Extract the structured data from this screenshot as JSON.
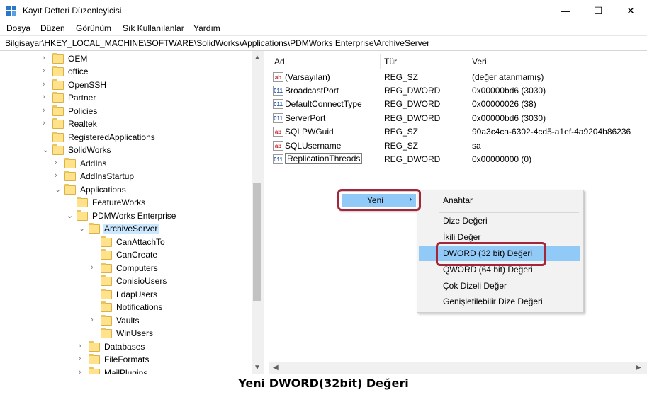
{
  "window": {
    "title": "Kayıt Defteri Düzenleyicisi",
    "minimize_glyph": "—",
    "maximize_glyph": "☐",
    "close_glyph": "✕"
  },
  "menu": [
    "Dosya",
    "Düzen",
    "Görünüm",
    "Sık Kullanılanlar",
    "Yardım"
  ],
  "address": "Bilgisayar\\HKEY_LOCAL_MACHINE\\SOFTWARE\\SolidWorks\\Applications\\PDMWorks Enterprise\\ArchiveServer",
  "tree": [
    {
      "label": "OEM",
      "expander": "›"
    },
    {
      "label": "office",
      "expander": "›"
    },
    {
      "label": "OpenSSH",
      "expander": "›"
    },
    {
      "label": "Partner",
      "expander": "›"
    },
    {
      "label": "Policies",
      "expander": "›"
    },
    {
      "label": "Realtek",
      "expander": "›"
    },
    {
      "label": "RegisteredApplications",
      "expander": ""
    },
    {
      "label": "SolidWorks",
      "expander": "⌄"
    },
    {
      "label": "AddIns",
      "expander": "›"
    },
    {
      "label": "AddInsStartup",
      "expander": "›"
    },
    {
      "label": "Applications",
      "expander": "⌄"
    },
    {
      "label": "FeatureWorks",
      "expander": ""
    },
    {
      "label": "PDMWorks Enterprise",
      "expander": "⌄"
    },
    {
      "label": "ArchiveServer",
      "expander": "⌄"
    },
    {
      "label": "CanAttachTo",
      "expander": ""
    },
    {
      "label": "CanCreate",
      "expander": ""
    },
    {
      "label": "Computers",
      "expander": "›"
    },
    {
      "label": "ConisioUsers",
      "expander": ""
    },
    {
      "label": "LdapUsers",
      "expander": ""
    },
    {
      "label": "Notifications",
      "expander": ""
    },
    {
      "label": "Vaults",
      "expander": "›"
    },
    {
      "label": "WinUsers",
      "expander": ""
    },
    {
      "label": "Databases",
      "expander": "›"
    },
    {
      "label": "FileFormats",
      "expander": "›"
    },
    {
      "label": "MailPlugins",
      "expander": "›"
    }
  ],
  "list": {
    "headers": {
      "name": "Ad",
      "type": "Tür",
      "data": "Veri"
    },
    "rows": [
      {
        "icon": "ab",
        "name": "(Varsayılan)",
        "type": "REG_SZ",
        "data": "(değer atanmamış)"
      },
      {
        "icon": "011",
        "name": "BroadcastPort",
        "type": "REG_DWORD",
        "data": "0x00000bd6 (3030)"
      },
      {
        "icon": "011",
        "name": "DefaultConnectType",
        "type": "REG_DWORD",
        "data": "0x00000026 (38)"
      },
      {
        "icon": "011",
        "name": "ServerPort",
        "type": "REG_DWORD",
        "data": "0x00000bd6 (3030)"
      },
      {
        "icon": "ab",
        "name": "SQLPWGuid",
        "type": "REG_SZ",
        "data": "90a3c4ca-6302-4cd5-a1ef-4a9204b86236"
      },
      {
        "icon": "ab",
        "name": "SQLUsername",
        "type": "REG_SZ",
        "data": "sa"
      },
      {
        "icon": "011",
        "name": "ReplicationThreads",
        "type": "REG_DWORD",
        "data": "0x00000000 (0)"
      }
    ]
  },
  "context_menu": {
    "parent_label": "Yeni",
    "parent_arrow": "›",
    "items": [
      "Anahtar",
      "Dize Değeri",
      "İkili Değer",
      "DWORD (32 bit) Değeri",
      "QWORD (64 bit) Değeri",
      "Çok Dizeli Değer",
      "Genişletilebilir Dize Değeri"
    ],
    "highlighted": "DWORD (32 bit) Değeri"
  },
  "caption": "Yeni DWORD(32bit) Değeri",
  "colors": {
    "highlight": "#91c9f7",
    "selection": "#cce8ff",
    "annotation": "#a3263a"
  }
}
